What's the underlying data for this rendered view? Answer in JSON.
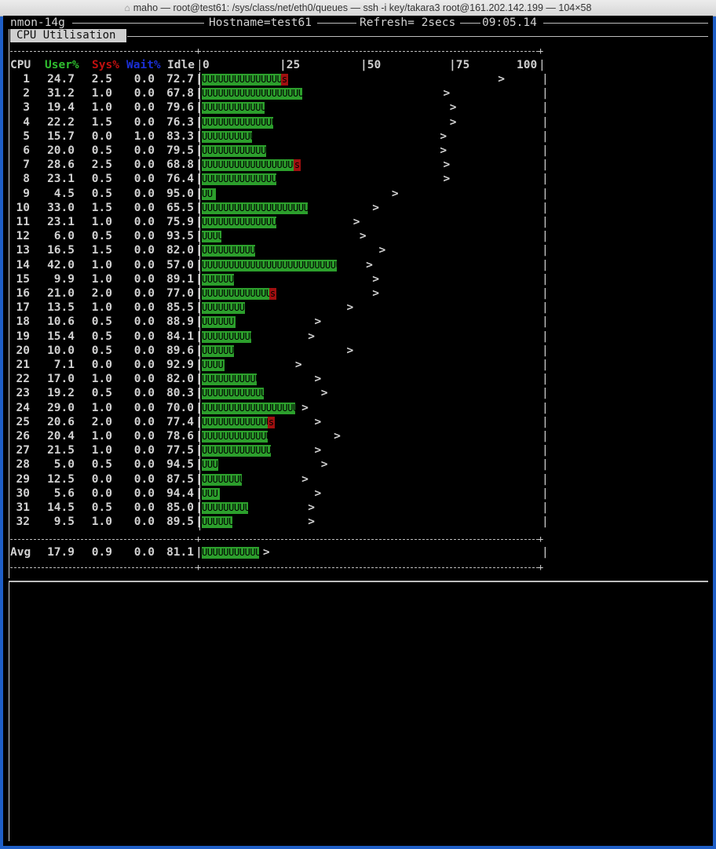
{
  "window": {
    "title": "maho — root@test61: /sys/class/net/eth0/queues — ssh -i key/takara3 root@161.202.142.199 — 104×58",
    "home_icon": "home-icon"
  },
  "nmon": {
    "version": "nmon-14g",
    "hostname": "Hostname=test61",
    "refresh": "Refresh= 2secs",
    "clock": "09:05.14",
    "section_tab": "CPU Utilisation"
  },
  "cpu_table": {
    "headers": {
      "cpu": "CPU",
      "user": "User%",
      "sys": "Sys%",
      "wait": "Wait%",
      "idle": "Idle"
    },
    "scale": [
      "0",
      "|25",
      "|50",
      "|75",
      "100"
    ],
    "colors": {
      "user": "#2fbf2f",
      "sys": "#c01010",
      "wait": "#1a2fd6",
      "bar_user": "#2c9f2c",
      "bar_sys": "#a01010"
    },
    "bar_glyph_user": "U",
    "bar_glyph_sys": "s",
    "peak_marker": ">",
    "rows": [
      {
        "cpu": "1",
        "user": "24.7",
        "sys": "2.5",
        "wait": "0.0",
        "idle": "72.7",
        "peak": 92
      },
      {
        "cpu": "2",
        "user": "31.2",
        "sys": "1.0",
        "wait": "0.0",
        "idle": "67.8",
        "peak": 75
      },
      {
        "cpu": "3",
        "user": "19.4",
        "sys": "1.0",
        "wait": "0.0",
        "idle": "79.6",
        "peak": 77
      },
      {
        "cpu": "4",
        "user": "22.2",
        "sys": "1.5",
        "wait": "0.0",
        "idle": "76.3",
        "peak": 77
      },
      {
        "cpu": "5",
        "user": "15.7",
        "sys": "0.0",
        "wait": "1.0",
        "idle": "83.3",
        "peak": 74
      },
      {
        "cpu": "6",
        "user": "20.0",
        "sys": "0.5",
        "wait": "0.0",
        "idle": "79.5",
        "peak": 74
      },
      {
        "cpu": "7",
        "user": "28.6",
        "sys": "2.5",
        "wait": "0.0",
        "idle": "68.8",
        "peak": 75
      },
      {
        "cpu": "8",
        "user": "23.1",
        "sys": "0.5",
        "wait": "0.0",
        "idle": "76.4",
        "peak": 75
      },
      {
        "cpu": "9",
        "user": "4.5",
        "sys": "0.5",
        "wait": "0.0",
        "idle": "95.0",
        "peak": 59
      },
      {
        "cpu": "10",
        "user": "33.0",
        "sys": "1.5",
        "wait": "0.0",
        "idle": "65.5",
        "peak": 53
      },
      {
        "cpu": "11",
        "user": "23.1",
        "sys": "1.0",
        "wait": "0.0",
        "idle": "75.9",
        "peak": 47
      },
      {
        "cpu": "12",
        "user": "6.0",
        "sys": "0.5",
        "wait": "0.0",
        "idle": "93.5",
        "peak": 49
      },
      {
        "cpu": "13",
        "user": "16.5",
        "sys": "1.5",
        "wait": "0.0",
        "idle": "82.0",
        "peak": 55
      },
      {
        "cpu": "14",
        "user": "42.0",
        "sys": "1.0",
        "wait": "0.0",
        "idle": "57.0",
        "peak": 51
      },
      {
        "cpu": "15",
        "user": "9.9",
        "sys": "1.0",
        "wait": "0.0",
        "idle": "89.1",
        "peak": 53
      },
      {
        "cpu": "16",
        "user": "21.0",
        "sys": "2.0",
        "wait": "0.0",
        "idle": "77.0",
        "peak": 53
      },
      {
        "cpu": "17",
        "user": "13.5",
        "sys": "1.0",
        "wait": "0.0",
        "idle": "85.5",
        "peak": 45
      },
      {
        "cpu": "18",
        "user": "10.6",
        "sys": "0.5",
        "wait": "0.0",
        "idle": "88.9",
        "peak": 35
      },
      {
        "cpu": "19",
        "user": "15.4",
        "sys": "0.5",
        "wait": "0.0",
        "idle": "84.1",
        "peak": 33
      },
      {
        "cpu": "20",
        "user": "10.0",
        "sys": "0.5",
        "wait": "0.0",
        "idle": "89.6",
        "peak": 45
      },
      {
        "cpu": "21",
        "user": "7.1",
        "sys": "0.0",
        "wait": "0.0",
        "idle": "92.9",
        "peak": 29
      },
      {
        "cpu": "22",
        "user": "17.0",
        "sys": "1.0",
        "wait": "0.0",
        "idle": "82.0",
        "peak": 35
      },
      {
        "cpu": "23",
        "user": "19.2",
        "sys": "0.5",
        "wait": "0.0",
        "idle": "80.3",
        "peak": 37
      },
      {
        "cpu": "24",
        "user": "29.0",
        "sys": "1.0",
        "wait": "0.0",
        "idle": "70.0",
        "peak": 31
      },
      {
        "cpu": "25",
        "user": "20.6",
        "sys": "2.0",
        "wait": "0.0",
        "idle": "77.4",
        "peak": 35
      },
      {
        "cpu": "26",
        "user": "20.4",
        "sys": "1.0",
        "wait": "0.0",
        "idle": "78.6",
        "peak": 41
      },
      {
        "cpu": "27",
        "user": "21.5",
        "sys": "1.0",
        "wait": "0.0",
        "idle": "77.5",
        "peak": 35
      },
      {
        "cpu": "28",
        "user": "5.0",
        "sys": "0.5",
        "wait": "0.0",
        "idle": "94.5",
        "peak": 37
      },
      {
        "cpu": "29",
        "user": "12.5",
        "sys": "0.0",
        "wait": "0.0",
        "idle": "87.5",
        "peak": 31
      },
      {
        "cpu": "30",
        "user": "5.6",
        "sys": "0.0",
        "wait": "0.0",
        "idle": "94.4",
        "peak": 35
      },
      {
        "cpu": "31",
        "user": "14.5",
        "sys": "0.5",
        "wait": "0.0",
        "idle": "85.0",
        "peak": 33
      },
      {
        "cpu": "32",
        "user": "9.5",
        "sys": "1.0",
        "wait": "0.0",
        "idle": "89.5",
        "peak": 33
      }
    ],
    "average": {
      "cpu": "Avg",
      "user": "17.9",
      "sys": "0.9",
      "wait": "0.0",
      "idle": "81.1",
      "peak": 19
    }
  }
}
